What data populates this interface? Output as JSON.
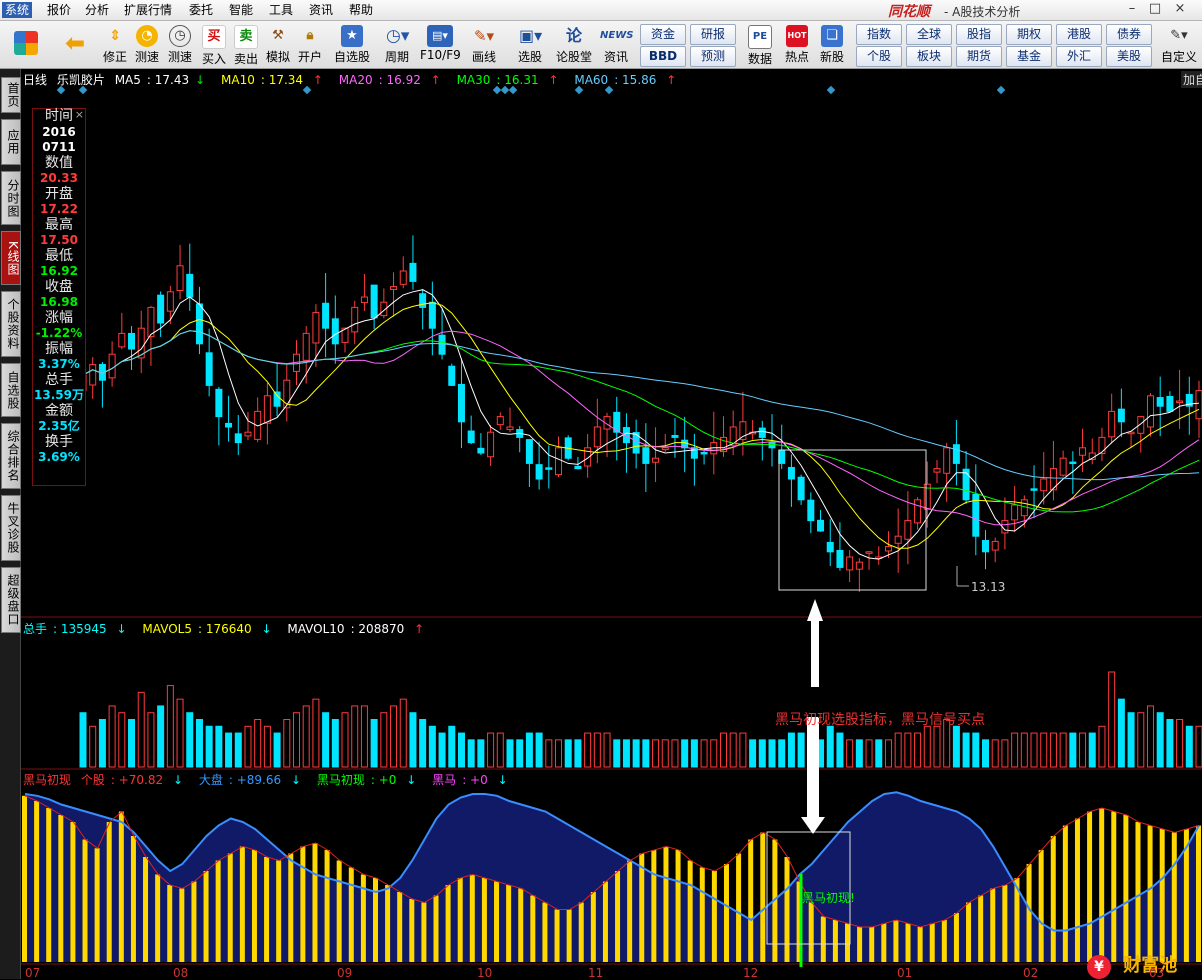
{
  "menu": [
    "系统",
    "报价",
    "分析",
    "扩展行情",
    "委托",
    "智能",
    "工具",
    "资讯",
    "帮助"
  ],
  "app": {
    "logo": "同花顺",
    "title": "- A股技术分析"
  },
  "window_buttons": [
    "–",
    "□",
    "×"
  ],
  "toolbar": {
    "buttons": [
      {
        "label": "",
        "icon": "grid-icon"
      },
      {
        "label": "",
        "icon": "back-arrow-icon"
      },
      {
        "label": "修正",
        "icon": "up-down-icon"
      },
      {
        "label": "测速",
        "icon": "speed-icon"
      },
      {
        "label": "买入",
        "icon": "buy-icon",
        "glyph": "买"
      },
      {
        "label": "卖出",
        "icon": "sell-icon",
        "glyph": "卖"
      },
      {
        "label": "模拟",
        "icon": "hammer-icon"
      },
      {
        "label": "开户",
        "icon": "lock-icon"
      },
      {
        "label": "自选股",
        "icon": "star-icon"
      },
      {
        "label": "周期",
        "icon": "clock-icon"
      },
      {
        "label": "F10/F9",
        "icon": "f10-icon"
      },
      {
        "label": "画线",
        "icon": "pen-icon"
      },
      {
        "label": "选股",
        "icon": "monitor-icon"
      },
      {
        "label": "论股堂",
        "icon": "lun-icon"
      },
      {
        "label": "资讯",
        "icon": "news-icon",
        "glyph": "NEWS"
      }
    ],
    "quick": [
      "资金",
      "研报",
      "BBD",
      "预测"
    ],
    "right_buttons": [
      {
        "label": "数据",
        "icon": "pe-icon",
        "glyph": "PE"
      },
      {
        "label": "热点",
        "icon": "hot-icon",
        "glyph": "HOT"
      },
      {
        "label": "新股",
        "icon": "newstock-icon"
      }
    ],
    "market_grid": [
      "指数",
      "全球",
      "股指",
      "期权",
      "港股",
      "债券",
      "个股",
      "板块",
      "期货",
      "基金",
      "外汇",
      "美股"
    ],
    "custom": "自定义"
  },
  "sidebar_tabs": [
    "首页",
    "应用",
    "分时图",
    "K线图",
    "个股资料",
    "自选股",
    "综合排名",
    "牛叉诊股",
    "超级盘口"
  ],
  "price_legend": {
    "period": "日线",
    "stock": "乐凯胶片",
    "ma": [
      {
        "name": "MA5",
        "value": "17.43",
        "dir": "↓",
        "color": "#ffffff"
      },
      {
        "name": "MA10",
        "value": "17.34",
        "dir": "↑",
        "color": "#ffff00"
      },
      {
        "name": "MA20",
        "value": "16.92",
        "dir": "↑",
        "color": "#ff66ff"
      },
      {
        "name": "MA30",
        "value": "16.31",
        "dir": "↑",
        "color": "#00ff00"
      },
      {
        "name": "MA60",
        "value": "15.86",
        "dir": "↑",
        "color": "#66ccff"
      }
    ],
    "add_label": "加自"
  },
  "infobox": [
    {
      "k": "时间",
      "v": "2016",
      "color": "#ffffff"
    },
    {
      "k": "",
      "v": "0711",
      "color": "#ffffff"
    },
    {
      "k": "数值",
      "v": "20.33",
      "color": "#ff3b3b"
    },
    {
      "k": "开盘",
      "v": "17.22",
      "color": "#ff3b3b"
    },
    {
      "k": "最高",
      "v": "17.50",
      "color": "#ff3b3b"
    },
    {
      "k": "最低",
      "v": "16.92",
      "color": "#00ee00"
    },
    {
      "k": "收盘",
      "v": "16.98",
      "color": "#00ee00"
    },
    {
      "k": "涨幅",
      "v": "-1.22%",
      "color": "#00ee00"
    },
    {
      "k": "振幅",
      "v": "3.37%",
      "color": "#00e5ff"
    },
    {
      "k": "总手",
      "v": "13.59万",
      "color": "#00e5ff"
    },
    {
      "k": "金额",
      "v": "2.35亿",
      "color": "#00e5ff"
    },
    {
      "k": "换手",
      "v": "3.69%",
      "color": "#00e5ff"
    }
  ],
  "low_marker": "13.13",
  "volume_legend": {
    "items": [
      {
        "name": "总手",
        "value": "135945",
        "dir": "↓",
        "color": "#00ffff"
      },
      {
        "name": "MAVOL5",
        "value": "176640",
        "dir": "↓",
        "color": "#ffff00"
      },
      {
        "name": "MAVOL10",
        "value": "208870",
        "dir": "↑",
        "color": "#ffffff"
      }
    ]
  },
  "indicator_legend": {
    "title": "黑马初现",
    "items": [
      {
        "name": "个股",
        "value": "+70.82",
        "dir": "↓",
        "color": "#ff3b3b"
      },
      {
        "name": "大盘",
        "value": "+89.66",
        "dir": "↓",
        "color": "#3399ff"
      },
      {
        "name": "黑马初现",
        "value": "+0",
        "dir": "↓",
        "color": "#00ff00"
      },
      {
        "name": "黑马",
        "value": "+0",
        "dir": "↓",
        "color": "#ff44ff"
      }
    ]
  },
  "annotation": "黑马初现选股指标，黑马信号买点",
  "signal_label": "黑马初现!",
  "x_axis_months": [
    "07",
    "08",
    "09",
    "10",
    "11",
    "12",
    "01",
    "02",
    "03"
  ],
  "watermark": "财富池",
  "colors": {
    "up": "#ff3b3b",
    "down": "#00e5ff",
    "ma5": "#ffffff",
    "ma10": "#ffff00",
    "ma20": "#ff66ff",
    "ma30": "#00ff00",
    "ma60": "#66ccff"
  },
  "chart_data": {
    "type": "candlestick",
    "stock": "乐凯胶片",
    "ylim": [
      12.5,
      22.5
    ],
    "months": [
      "07",
      "08",
      "09",
      "10",
      "11",
      "12",
      "01",
      "02",
      "03"
    ],
    "close": [
      17.0,
      17.2,
      16.9,
      17.4,
      17.8,
      17.5,
      17.9,
      18.3,
      18.0,
      18.6,
      19.1,
      18.5,
      17.6,
      16.8,
      16.2,
      16.0,
      15.7,
      15.9,
      16.3,
      16.6,
      16.4,
      16.9,
      17.4,
      17.8,
      18.2,
      17.9,
      17.6,
      17.9,
      18.3,
      18.5,
      18.1,
      18.4,
      18.7,
      19.0,
      18.8,
      18.3,
      17.9,
      17.4,
      16.8,
      16.1,
      15.7,
      15.5,
      15.9,
      16.2,
      16.0,
      15.8,
      15.3,
      15.0,
      15.2,
      15.6,
      15.4,
      15.2,
      15.6,
      16.0,
      16.2,
      15.9,
      15.7,
      15.5,
      15.3,
      15.4,
      15.6,
      15.8,
      15.6,
      15.4,
      15.5,
      15.7,
      15.8,
      16.0,
      16.1,
      15.9,
      15.8,
      15.6,
      15.3,
      15.0,
      14.6,
      14.2,
      14.0,
      13.6,
      13.3,
      13.5,
      13.4,
      13.6,
      13.5,
      13.7,
      13.9,
      14.2,
      14.6,
      14.9,
      15.2,
      15.6,
      15.3,
      14.6,
      13.9,
      13.6,
      13.8,
      14.2,
      14.5,
      14.6,
      14.8,
      15.0,
      15.2,
      15.4,
      15.3,
      15.6,
      15.5,
      15.8,
      16.3,
      16.1,
      15.9,
      16.2,
      16.6,
      16.4,
      16.3,
      16.5,
      16.4,
      16.7
    ],
    "volume": [
      8,
      6,
      7,
      9,
      8,
      7,
      11,
      8,
      9,
      12,
      10,
      8,
      7,
      6,
      6,
      5,
      5,
      6,
      7,
      6,
      5,
      7,
      8,
      9,
      10,
      8,
      7,
      8,
      9,
      9,
      7,
      8,
      9,
      10,
      8,
      7,
      6,
      5,
      6,
      5,
      4,
      4,
      5,
      5,
      4,
      4,
      5,
      5,
      4,
      4,
      4,
      4,
      5,
      5,
      5,
      4,
      4,
      4,
      4,
      4,
      4,
      4,
      4,
      4,
      4,
      4,
      5,
      5,
      5,
      4,
      4,
      4,
      4,
      5,
      5,
      4,
      4,
      6,
      5,
      4,
      4,
      4,
      4,
      4,
      5,
      5,
      5,
      6,
      6,
      7,
      6,
      5,
      5,
      4,
      4,
      4,
      5,
      5,
      5,
      5,
      5,
      5,
      5,
      5,
      5,
      6,
      14,
      10,
      8,
      8,
      9,
      8,
      7,
      7,
      6,
      6
    ],
    "indicator_stock": [
      95,
      92,
      88,
      84,
      80,
      70,
      65,
      80,
      86,
      72,
      60,
      50,
      44,
      42,
      46,
      52,
      58,
      62,
      66,
      64,
      60,
      58,
      62,
      66,
      68,
      64,
      58,
      54,
      50,
      48,
      44,
      40,
      36,
      34,
      38,
      44,
      48,
      50,
      48,
      46,
      44,
      42,
      38,
      34,
      30,
      30,
      34,
      40,
      46,
      52,
      58,
      62,
      64,
      66,
      64,
      58,
      54,
      52,
      56,
      62,
      70,
      74,
      70,
      60,
      46,
      34,
      26,
      24,
      22,
      20,
      20,
      22,
      24,
      22,
      20,
      22,
      24,
      28,
      34,
      38,
      42,
      44,
      48,
      56,
      64,
      72,
      78,
      82,
      86,
      88,
      86,
      84,
      80,
      78,
      76,
      74,
      76,
      78
    ],
    "indicator_market": [
      96,
      95,
      93,
      90,
      88,
      86,
      84,
      82,
      80,
      74,
      66,
      58,
      52,
      56,
      64,
      72,
      78,
      82,
      80,
      76,
      70,
      64,
      58,
      54,
      50,
      48,
      46,
      44,
      42,
      40,
      42,
      48,
      58,
      70,
      82,
      90,
      94,
      96,
      96,
      95,
      92,
      90,
      88,
      86,
      82,
      78,
      74,
      70,
      66,
      62,
      58,
      54,
      50,
      48,
      46,
      44,
      40,
      36,
      32,
      28,
      24,
      30,
      36,
      42,
      50,
      56,
      64,
      72,
      80,
      86,
      92,
      96,
      97,
      95,
      92,
      90,
      88,
      86,
      82,
      76,
      66,
      54,
      42,
      30,
      22,
      18,
      18,
      20,
      22,
      26,
      30,
      34,
      38,
      42,
      48,
      56,
      66,
      78
    ],
    "signal_index": 86
  }
}
